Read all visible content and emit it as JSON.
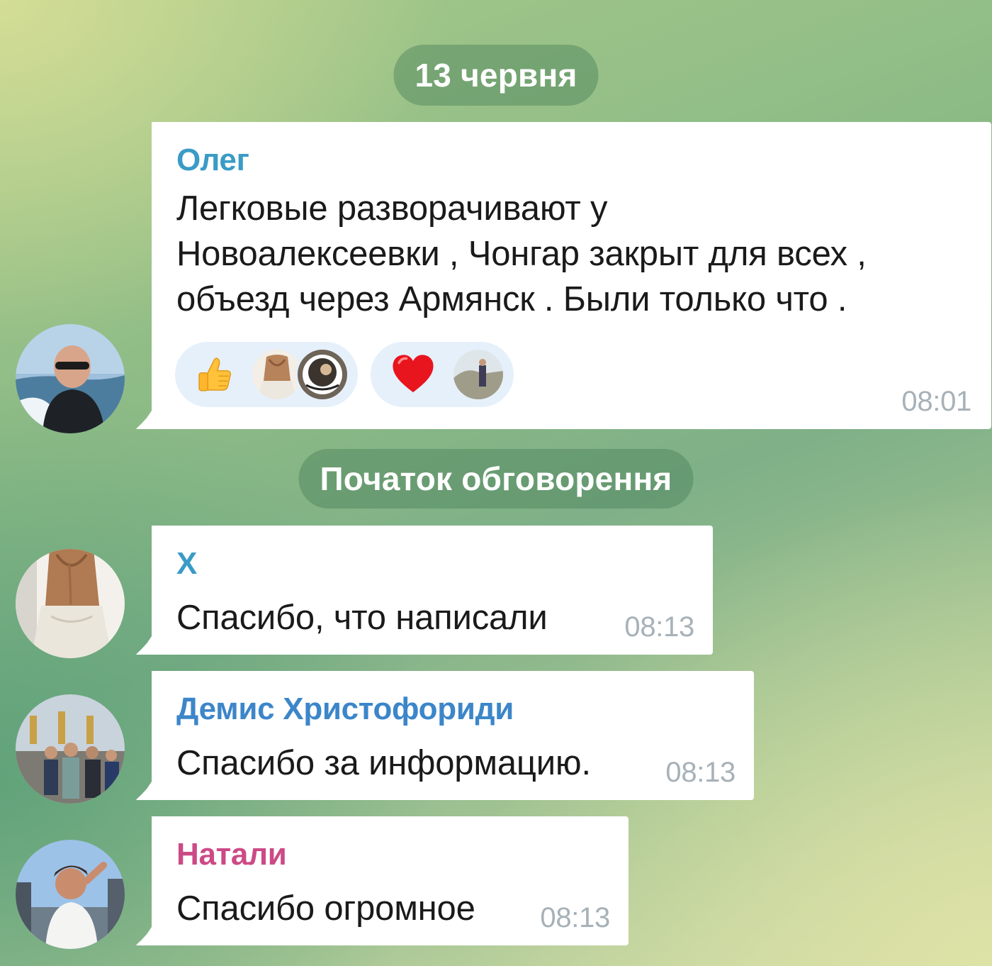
{
  "date_separator": "13 червня",
  "thread_separator": "Початок обговорення",
  "colors": {
    "sender_oleg": "#3a9bc6",
    "sender_x": "#3a9bc6",
    "sender_demis": "#3c86c9",
    "sender_natali": "#cc4a86",
    "time": "#a7b1b8"
  },
  "messages": [
    {
      "sender": "Олег",
      "text_lines": [
        "Легковые разворачивают у",
        "Новоалексеевки , Чонгар закрыт для всех ,",
        "объезд через Армянск . Были только что ."
      ],
      "time": "08:01",
      "reactions": [
        {
          "emoji": "thumbs-up-icon",
          "count_avatars": 2
        },
        {
          "emoji": "red-heart-icon",
          "count_avatars": 1
        }
      ]
    },
    {
      "sender": "X",
      "text": "Спасибо,  что написали",
      "time": "08:13"
    },
    {
      "sender": "Демис Христофориди",
      "text": "Спасибо за информацию.",
      "time": "08:13"
    },
    {
      "sender": "Натали",
      "text": "Спасибо огромное",
      "time": "08:13"
    }
  ]
}
